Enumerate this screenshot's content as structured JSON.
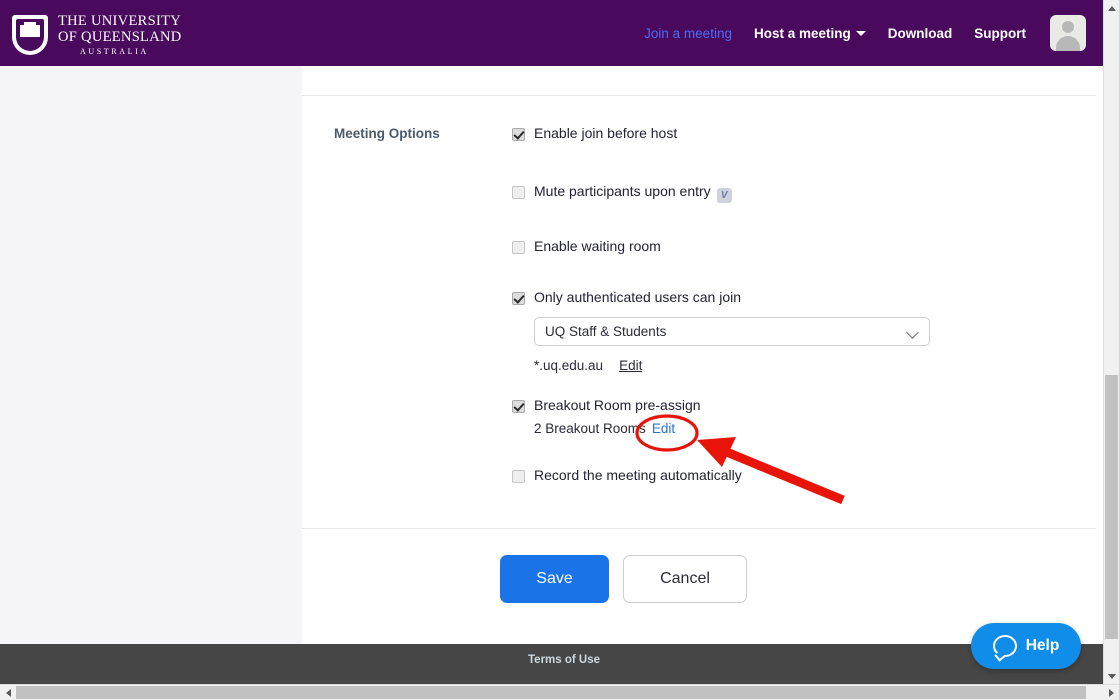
{
  "header": {
    "logo": {
      "line1": "THE UNIVERSITY",
      "line2": "OF QUEENSLAND",
      "line3": "AUSTRALIA"
    },
    "nav": {
      "join": "Join a meeting",
      "host": "Host a meeting",
      "download": "Download",
      "support": "Support"
    },
    "brand_color": "#490A5E",
    "join_link_color": "#4a6cf7"
  },
  "form": {
    "section_label": "Meeting Options",
    "options": [
      {
        "label": "Enable join before host",
        "checked": true,
        "has_info": false
      },
      {
        "label": "Mute participants upon entry",
        "checked": false,
        "has_info": true,
        "info_glyph": "V"
      },
      {
        "label": "Enable waiting room",
        "checked": false,
        "has_info": false
      },
      {
        "label": "Only authenticated users can join",
        "checked": true,
        "has_info": false
      },
      {
        "label": "Breakout Room pre-assign",
        "checked": true,
        "has_info": false
      },
      {
        "label": "Record the meeting automatically",
        "checked": false,
        "has_info": false
      }
    ],
    "auth_select": {
      "value": "UQ Staff & Students",
      "domain_text": "*.uq.edu.au",
      "edit_label": "Edit"
    },
    "breakout": {
      "count_text": "2 Breakout Rooms",
      "edit_label": "Edit"
    },
    "buttons": {
      "save": "Save",
      "cancel": "Cancel"
    },
    "save_color": "#1a74e8"
  },
  "footer": {
    "terms": "Terms of Use"
  },
  "help": {
    "label": "Help",
    "color": "#0f8de8"
  },
  "annotation": {
    "highlight_color": "#e8140a",
    "highlighted_target": "Edit"
  }
}
